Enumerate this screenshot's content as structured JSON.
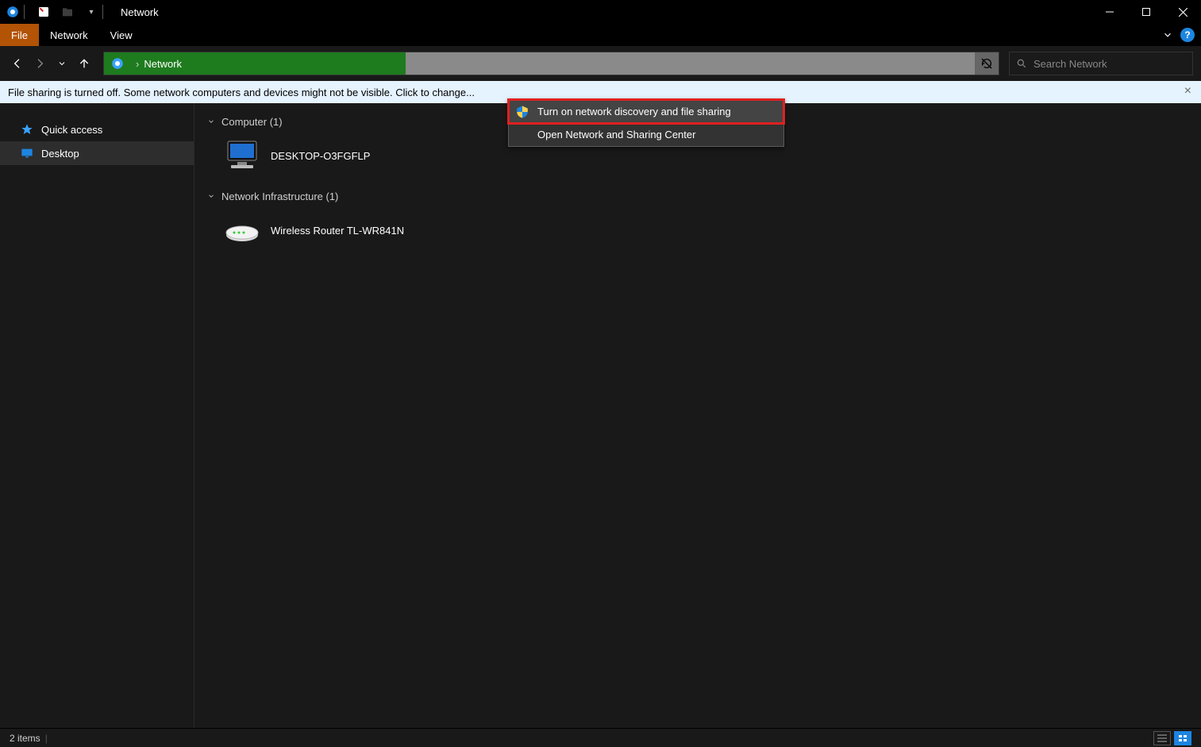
{
  "window": {
    "title": "Network"
  },
  "ribbon": {
    "tabs": {
      "file": "File",
      "network": "Network",
      "view": "View"
    }
  },
  "address": {
    "location": "Network"
  },
  "search": {
    "placeholder": "Search Network"
  },
  "infobar": {
    "message": "File sharing is turned off. Some network computers and devices might not be visible. Click to change..."
  },
  "context_menu": {
    "items": [
      "Turn on network discovery and file sharing",
      "Open Network and Sharing Center"
    ]
  },
  "sidebar": {
    "quick_access": "Quick access",
    "desktop": "Desktop"
  },
  "content": {
    "groups": [
      {
        "header": "Computer (1)",
        "item": "DESKTOP-O3FGFLP"
      },
      {
        "header": "Network Infrastructure (1)",
        "item": "Wireless Router TL-WR841N"
      }
    ]
  },
  "status": {
    "count": "2 items"
  }
}
